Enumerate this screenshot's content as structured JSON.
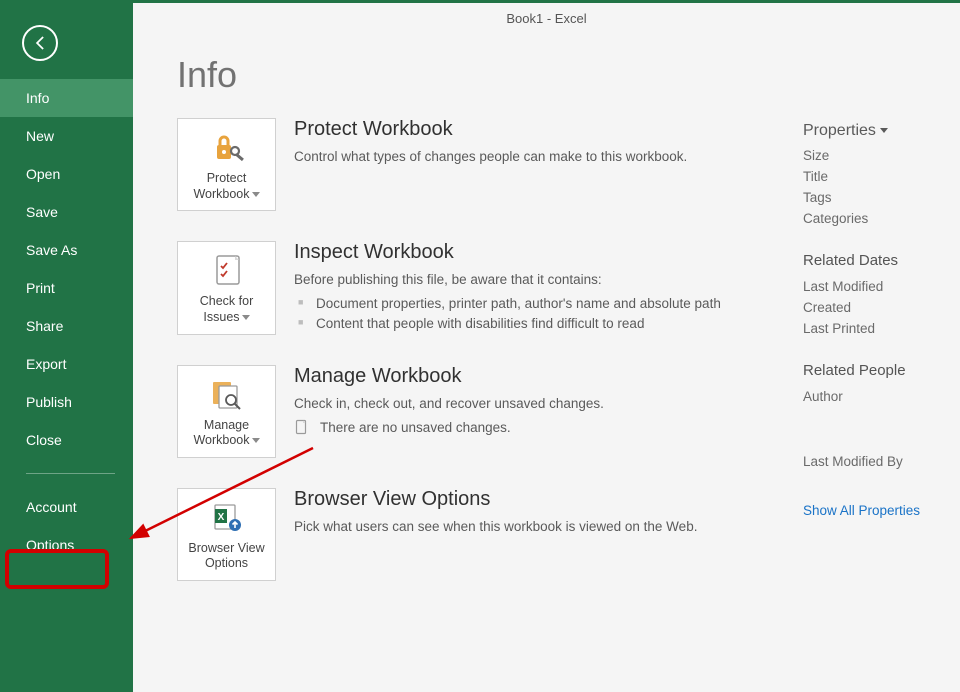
{
  "window_title": "Book1 - Excel",
  "page_title": "Info",
  "sidebar": {
    "items": [
      "Info",
      "New",
      "Open",
      "Save",
      "Save As",
      "Print",
      "Share",
      "Export",
      "Publish",
      "Close",
      "Account",
      "Options"
    ],
    "active_index": 0
  },
  "sections": {
    "protect": {
      "tile_label": "Protect Workbook",
      "title": "Protect Workbook",
      "desc": "Control what types of changes people can make to this workbook."
    },
    "inspect": {
      "tile_label": "Check for Issues",
      "title": "Inspect Workbook",
      "desc": "Before publishing this file, be aware that it contains:",
      "items": [
        "Document properties, printer path, author's name and absolute path",
        "Content that people with disabilities find difficult to read"
      ]
    },
    "manage": {
      "tile_label": "Manage Workbook",
      "title": "Manage Workbook",
      "desc": "Check in, check out, and recover unsaved changes.",
      "no_changes": "There are no unsaved changes."
    },
    "browser": {
      "tile_label": "Browser View Options",
      "title": "Browser View Options",
      "desc": "Pick what users can see when this workbook is viewed on the Web."
    }
  },
  "properties": {
    "heading": "Properties",
    "rows": [
      "Size",
      "Title",
      "Tags",
      "Categories"
    ],
    "dates_heading": "Related Dates",
    "dates_rows": [
      "Last Modified",
      "Created",
      "Last Printed"
    ],
    "people_heading": "Related People",
    "people_author": "Author",
    "last_mod_by": "Last Modified By",
    "show_all": "Show All Properties"
  },
  "annotation": {
    "target_sidebar_index": 11
  }
}
